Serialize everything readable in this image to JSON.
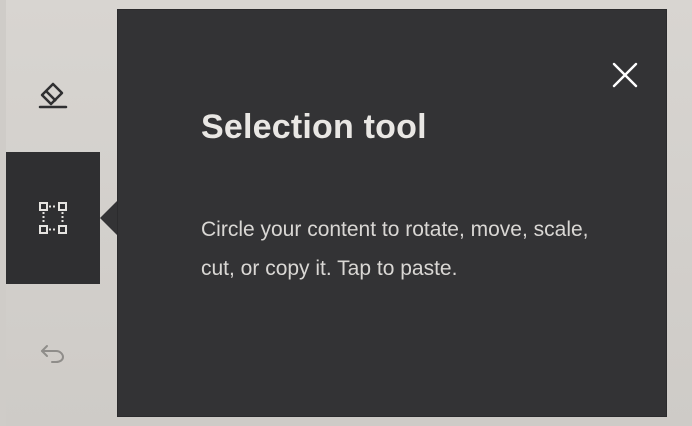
{
  "toolbar": {
    "items": [
      {
        "name": "Eraser",
        "icon": "eraser-icon"
      },
      {
        "name": "Selection tool",
        "icon": "selection-tool-icon",
        "active": true
      },
      {
        "name": "Undo",
        "icon": "undo-icon"
      }
    ]
  },
  "popup": {
    "title": "Selection tool",
    "body": "Circle your content to rotate, move, scale, cut, or copy it. Tap to paste.",
    "close_icon": "close-icon"
  },
  "colors": {
    "popup_background": "#333335",
    "screen_background": "#d4d1cd",
    "text_primary": "#e9e7e4"
  }
}
